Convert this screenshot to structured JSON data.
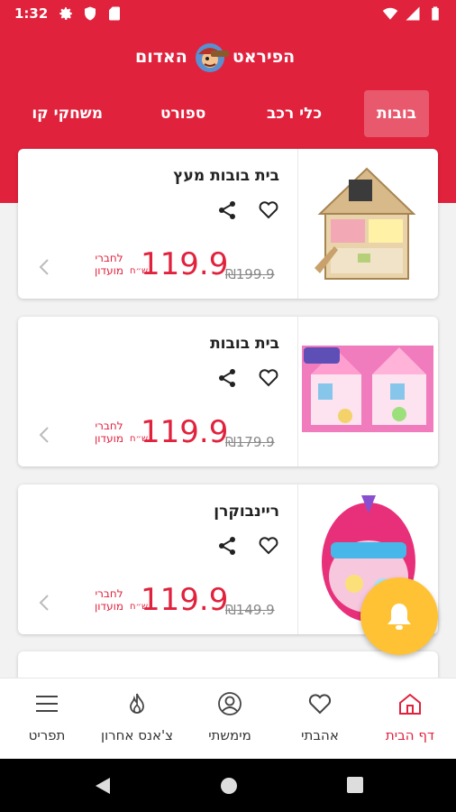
{
  "status_bar": {
    "time": "1:32"
  },
  "header": {
    "logo_text_right": "הפיראט",
    "logo_text_left": "האדום"
  },
  "categories": [
    {
      "label": "בובות",
      "active": true
    },
    {
      "label": "כלי רכב",
      "active": false
    },
    {
      "label": "ספורט",
      "active": false
    },
    {
      "label": "משחקי קו",
      "active": false
    }
  ],
  "products": [
    {
      "title": "בית בובות מעץ",
      "price": "119.9",
      "price_currency": "ש״ח",
      "old_price": "199.9",
      "old_price_currency": "₪",
      "club_label": "לחברי מועדון"
    },
    {
      "title": "בית בובות",
      "price": "119.9",
      "price_currency": "ש״ח",
      "old_price": "179.9",
      "old_price_currency": "₪",
      "club_label": "לחברי מועדון"
    },
    {
      "title": "ריינבוקרן",
      "price": "119.9",
      "price_currency": "ש״ח",
      "old_price": "149.9",
      "old_price_currency": "₪",
      "club_label": "לחברי מועדון"
    }
  ],
  "bottom_nav": [
    {
      "label": "דף הבית",
      "icon": "home-icon",
      "active": true
    },
    {
      "label": "אהבתי",
      "icon": "heart-icon",
      "active": false
    },
    {
      "label": "מימשתי",
      "icon": "user-icon",
      "active": false
    },
    {
      "label": "צ'אנס אחרון",
      "icon": "flame-icon",
      "active": false
    },
    {
      "label": "תפריט",
      "icon": "menu-icon",
      "active": false
    }
  ],
  "colors": {
    "brand_red": "#e1223d",
    "bell_yellow": "#ffc234",
    "text_dark": "#222222"
  }
}
